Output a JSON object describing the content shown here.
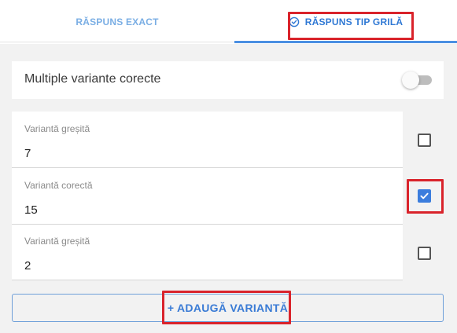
{
  "tabs": [
    {
      "label": "RĂSPUNS EXACT",
      "active": false
    },
    {
      "label": "RĂSPUNS TIP GRILĂ",
      "active": true,
      "icon": "check-circle-icon"
    }
  ],
  "toggle": {
    "label": "Multiple variante corecte",
    "on": false
  },
  "options": [
    {
      "label": "Variantă greșită",
      "value": "7",
      "correct": false
    },
    {
      "label": "Variantă corectă",
      "value": "15",
      "correct": true
    },
    {
      "label": "Variantă greșită",
      "value": "2",
      "correct": false
    }
  ],
  "add_button": {
    "label": "+ ADAUGĂ VARIANTĂ"
  },
  "colors": {
    "accent": "#3b7ddd",
    "highlight": "#d9232b"
  }
}
